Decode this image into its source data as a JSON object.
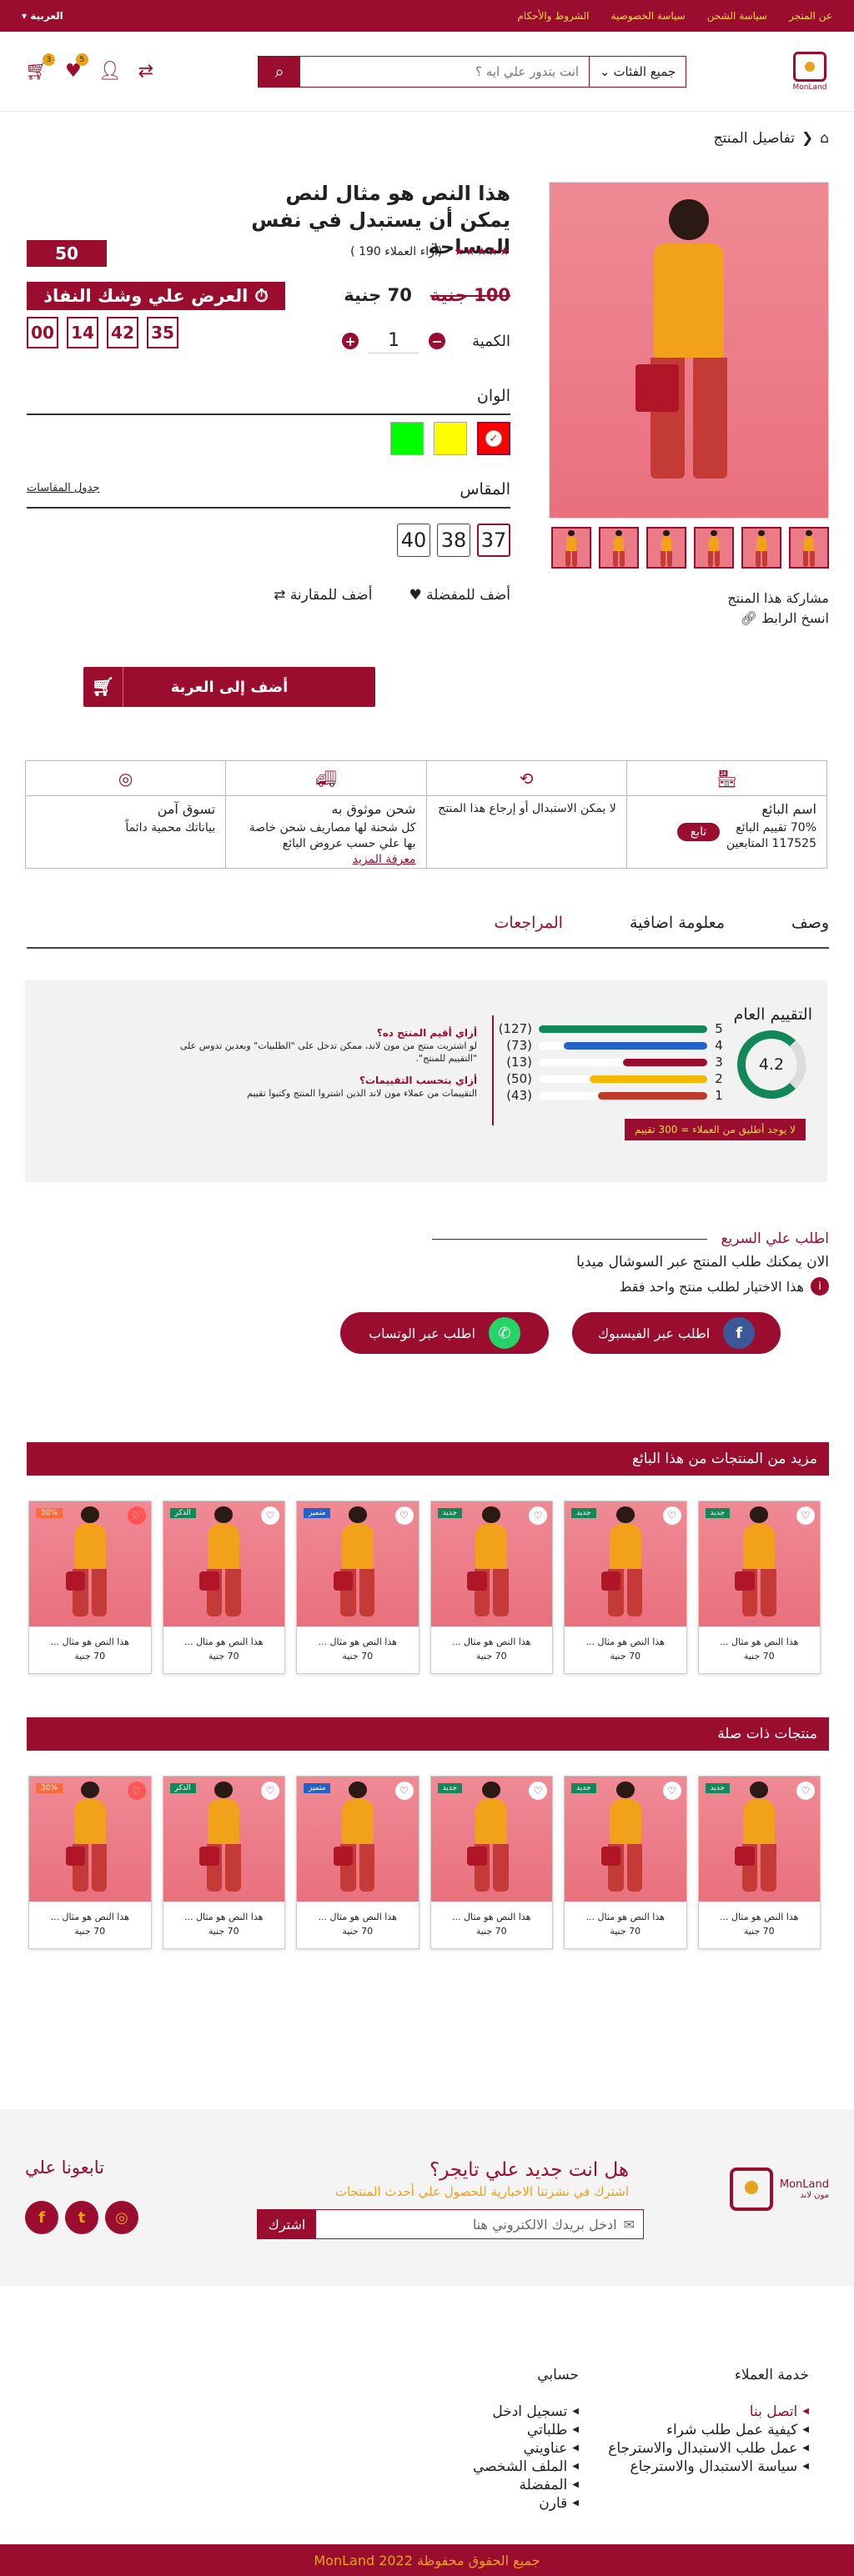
{
  "topbar": {
    "links": [
      "عن المتجر",
      "سياسة الشحن",
      "سياسة الخصوصية",
      "الشروط والأحكام"
    ],
    "lang": "العربية"
  },
  "header": {
    "logo_text": "MonLand",
    "logo_sub": "مون لاند",
    "search_placeholder": "انت بتدور علي ايه ؟",
    "category": "جميع الفئات",
    "cart_count": "3",
    "fav_count": "5"
  },
  "breadcrumb": "تفاصيل المنتج",
  "product": {
    "title": "هذا النص هو مثال لنص يمكن أن يستبدل في نفس المساحة",
    "rating_text": "(أراء العملاء 190 )",
    "stock": "50",
    "old_price": "100 جنية",
    "price": "70 جنية",
    "offer": "العرض علي وشك النفاذ",
    "timer": [
      "00",
      "14",
      "42",
      "35"
    ],
    "qty_label": "الكمية",
    "qty": "1",
    "colors_label": "الوان",
    "sizes_label": "المقاس",
    "size_guide": "جدول المقاسات",
    "sizes": [
      "37",
      "38",
      "40"
    ],
    "fav": "أضف للمفضلة",
    "compare": "أضف للمقارنة",
    "add_cart": "أضف إلى العربة",
    "share_label": "مشاركة هذا المنتج",
    "copy_link": "انسخ الرابط"
  },
  "features": {
    "vendor": {
      "title": "اسم البائع",
      "rating": "70% تقييم البائع",
      "followers": "117525 المتابعين",
      "follow": "تابع"
    },
    "returns": {
      "text": "لا يمكن الاستبدال أو إرجاع هذا المنتج"
    },
    "shipping": {
      "title": "شحن موثوق به",
      "text": "كل شحنة لها مصاريف شحن خاصة بها علي حسب عروض البائع",
      "more": "معرفة المزيد"
    },
    "secure": {
      "title": "تسوق آمن",
      "text": "بياناتك محمية دائماً"
    }
  },
  "tabs": [
    "وصف",
    "معلومة اضافية",
    "المراجعات"
  ],
  "reviews": {
    "title": "التقييم العام",
    "score": "4.2",
    "rows": [
      {
        "star": "5",
        "count": "(127)"
      },
      {
        "star": "4",
        "count": "(73)"
      },
      {
        "star": "3",
        "count": "(13)"
      },
      {
        "star": "2",
        "count": "(50)"
      },
      {
        "star": "1",
        "count": "(43)"
      }
    ],
    "note": "لا يوجد أطليق من العملاء = 300 تقييم",
    "q1": "أزاي أقيم المنتج ده؟",
    "a1": "لو اشتريت منتج من مون لاند، ممكن تدخل على \"الطلبيات\" وبعدين تدوس على \"التقييم للمنتج\".",
    "q2": "أزاي بتحسب التقييمات؟",
    "a2": "التقييمات من عملاء مون لاند الذين اشتروا المنتج وكتبوا تقييم"
  },
  "quick": {
    "title": "اطلب علي السريع",
    "text": "الان يمكنك طلب المنتج عبر السوشال ميديا",
    "note": "هذا الاختيار لطلب منتج واحد فقط",
    "fb": "اطلب عبر الفيسبوك",
    "wa": "اطلب عبر الوتساب"
  },
  "more_title": "مزيد من المنتجات من هذا البائع",
  "related_title": "منتجات ذات صلة",
  "cards": [
    {
      "tag": "جديد",
      "name": "هذا النص هو مثال ...",
      "price": "70 جنية"
    },
    {
      "tag": "جديد",
      "name": "هذا النص هو مثال ...",
      "price": "70 جنية"
    },
    {
      "tag": "جديد",
      "name": "هذا النص هو مثال ...",
      "price": "70 جنية"
    },
    {
      "tag": "متميز",
      "name": "هذا النص هو مثال ...",
      "price": "70 جنية"
    },
    {
      "tag": "الذكر",
      "name": "هذا النص هو مثال ...",
      "price": "70 جنية"
    },
    {
      "tag": "30%",
      "name": "هذا النص هو مثال ...",
      "price": "70 جنية"
    }
  ],
  "newsletter": {
    "title": "هل انت جديد علي تايجر؟",
    "sub": "اشترك في نشرتنا الاخبارية للحصول علي أحدث المنتجات",
    "placeholder": "ادخل بريدك الالكتروني هنا",
    "btn": "اشترك",
    "follow": "تابعونا علي"
  },
  "footer": {
    "service_title": "خدمة العملاء",
    "service": [
      "اتصل بنا",
      "كيفية عمل طلب شراء",
      "عمل طلب الاستبدال والاسترجاع",
      "سياسة الاستبدال والاسترجاع"
    ],
    "account_title": "حسابي",
    "account": [
      "تسجيل ادخل",
      "طلباتي",
      "عناويني",
      "الملف الشخصي",
      "المفضلة",
      "قارن"
    ],
    "copyright": "جميع الحقوق محفوظة  MonLand 2022"
  },
  "colors": {
    "brand": "#9a0d2e",
    "accent": "#e8a21c",
    "swatches": [
      "#ff0000",
      "#ffff00",
      "#00ff00"
    ]
  }
}
